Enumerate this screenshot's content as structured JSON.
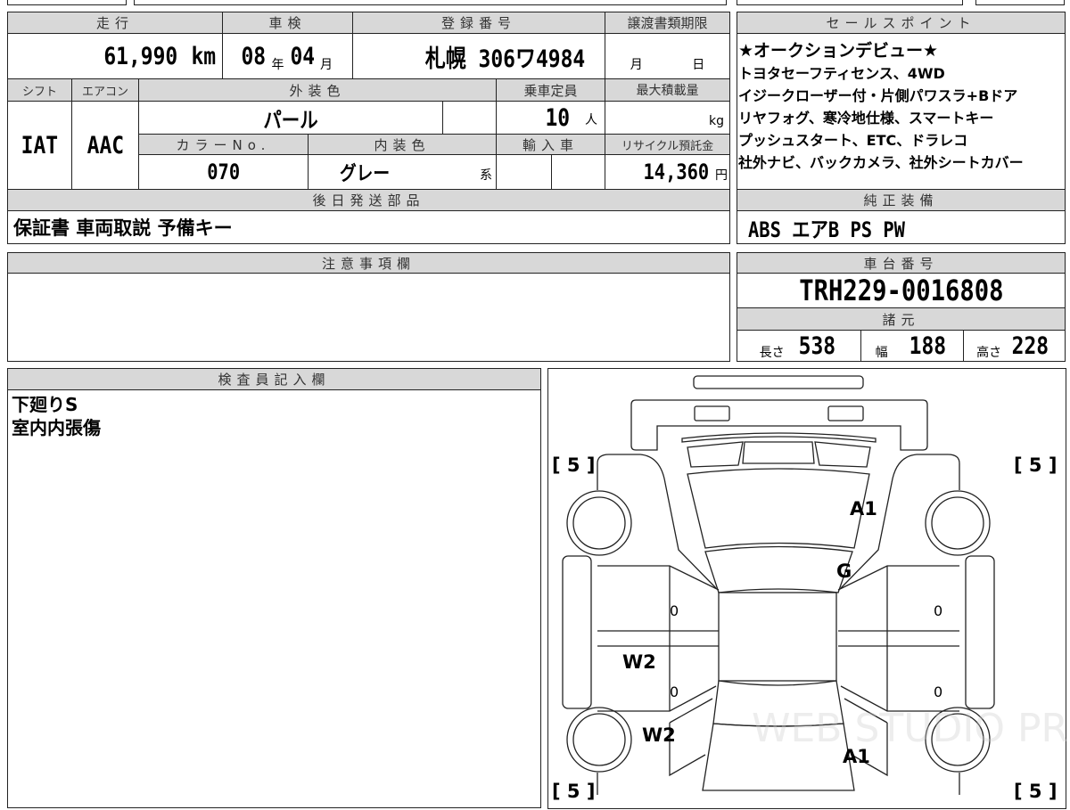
{
  "mileage": {
    "label": "走行",
    "value": "61,990",
    "unit": "km"
  },
  "inspection": {
    "label": "車検",
    "year": "08",
    "year_unit": "年",
    "month": "04",
    "month_unit": "月"
  },
  "registration": {
    "label": "登録番号",
    "value": "札幌 306ワ4984"
  },
  "transfer_deadline": {
    "label": "譲渡書類期限",
    "month_unit": "月",
    "day_unit": "日"
  },
  "shift": {
    "label": "シフト",
    "value": "IAT"
  },
  "aircon": {
    "label": "エアコン",
    "value": "AAC"
  },
  "exterior_color": {
    "label": "外装色",
    "value": "パール"
  },
  "capacity": {
    "label": "乗車定員",
    "value": "10",
    "unit": "人"
  },
  "max_load": {
    "label": "最大積載量",
    "unit": "kg"
  },
  "color_no": {
    "label": "カラーNo.",
    "value": "070"
  },
  "interior_color": {
    "label": "内装色",
    "value": "グレー",
    "suffix": "系"
  },
  "import": {
    "label": "輸入車"
  },
  "recycle": {
    "label": "リサイクル預託金",
    "value": "14,360",
    "unit": "円"
  },
  "later_parts": {
    "label": "後日発送部品",
    "value": "保証書 車両取説 予備キー"
  },
  "sales_points": {
    "label": "セールスポイント",
    "lines": [
      "★オークションデビュー★",
      "トヨタセーフティセンス、4WD",
      "イジークローザー付・片側パワスラ+Bドア",
      "リヤフォグ、寒冷地仕様、スマートキー",
      "プッシュスタート、ETC、ドラレコ",
      "社外ナビ、バックカメラ、社外シートカバー"
    ]
  },
  "genuine_equipment": {
    "label": "純正装備",
    "value": "ABS エアB PS PW"
  },
  "notes": {
    "label": "注意事項欄"
  },
  "chassis": {
    "label": "車台番号",
    "value": "TRH229-0016808"
  },
  "specs": {
    "label": "諸元",
    "length_label": "長さ",
    "length": "538",
    "width_label": "幅",
    "width": "188",
    "height_label": "高さ",
    "height": "228"
  },
  "inspector": {
    "label": "検査員記入欄",
    "lines": [
      "下廻りS",
      "室内内張傷"
    ]
  },
  "diagram": {
    "marks": {
      "corner_fl": "[ 5 ]",
      "corner_fr": "[ 5 ]",
      "corner_rl": "[ 5 ]",
      "corner_rr": "[ 5 ]",
      "hood": "A1",
      "windshield": "G",
      "rear": "A1",
      "left_rear_door": "W2",
      "left_rear_fender": "W2",
      "door_lf": "0",
      "door_lr": "0",
      "door_rf": "0",
      "door_rr": "0"
    },
    "watermark": "WEB STUDIO PRO"
  }
}
